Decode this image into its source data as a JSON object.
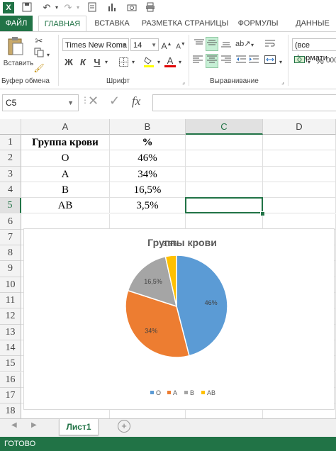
{
  "title_bar": {
    "qat_icons": [
      "excel-icon",
      "save-icon",
      "undo-icon",
      "redo-icon",
      "open-icon",
      "chart-icon",
      "camera-icon",
      "print-icon"
    ]
  },
  "ribbon_tabs": [
    "ФАЙЛ",
    "ГЛАВНАЯ",
    "ВСТАВКА",
    "РАЗМЕТКА СТРАНИЦЫ",
    "ФОРМУЛЫ",
    "ДАННЫЕ"
  ],
  "ribbon": {
    "paste_label": "Вставить",
    "clipboard_group": "Буфер обмена",
    "font_name": "Times New Roma",
    "font_size": "14",
    "bold": "Ж",
    "italic": "К",
    "underline": "Ч",
    "font_group": "Шрифт",
    "align_group": "Выравнивание",
    "number_format": "(все формати"
  },
  "formula_bar": {
    "name_box": "C5",
    "fx": "fx",
    "formula": ""
  },
  "sheet": {
    "columns": [
      "A",
      "B",
      "C",
      "D"
    ],
    "rows": [
      "1",
      "2",
      "3",
      "4",
      "5",
      "6",
      "7",
      "8",
      "9",
      "10",
      "11",
      "12",
      "13",
      "14",
      "15",
      "16",
      "17",
      "18"
    ],
    "selected_cell": "C5",
    "header": [
      "Группа крови",
      "%"
    ],
    "data": [
      [
        "O",
        "46%"
      ],
      [
        "A",
        "34%"
      ],
      [
        "B",
        "16,5%"
      ],
      [
        "AB",
        "3,5%"
      ]
    ]
  },
  "chart_data": {
    "type": "pie",
    "title": "Группы крови",
    "categories": [
      "O",
      "A",
      "B",
      "AB"
    ],
    "values": [
      46,
      34,
      16.5,
      3.5
    ],
    "labels": [
      "46%",
      "34%",
      "16,5%",
      "3,5%"
    ],
    "colors": [
      "#5b9bd5",
      "#ed7d31",
      "#a5a5a5",
      "#ffc000"
    ],
    "legend": "bottom"
  },
  "sheet_tabs": {
    "active": "Лист1",
    "add": "+"
  },
  "status": "ГОТОВО",
  "colors": {
    "accent": "#217346"
  }
}
